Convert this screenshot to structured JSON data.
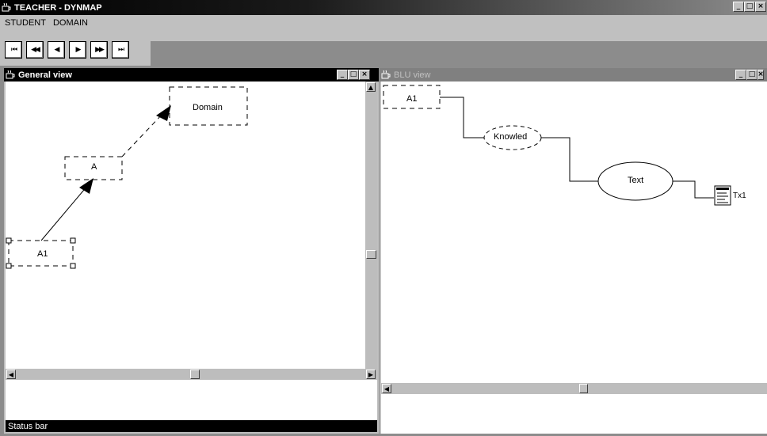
{
  "app": {
    "title": "TEACHER - DYNMAP"
  },
  "menu": {
    "items": [
      "STUDENT",
      "DOMAIN"
    ]
  },
  "toolbar": {
    "buttons": [
      {
        "name": "first",
        "glyph": "⏮"
      },
      {
        "name": "fast-back",
        "glyph": "◀◀"
      },
      {
        "name": "back",
        "glyph": "◀"
      },
      {
        "name": "play",
        "glyph": "▶"
      },
      {
        "name": "fast-forward",
        "glyph": "▶▶"
      },
      {
        "name": "last",
        "glyph": "⏭"
      }
    ]
  },
  "general_view": {
    "title": "General view",
    "nodes": {
      "domain": "Domain",
      "a": "A",
      "a1": "A1"
    },
    "status": "Status bar"
  },
  "blu_view": {
    "title": "BLU view",
    "nodes": {
      "a1": "A1",
      "knowledge": "Knowled",
      "text": "Text",
      "tx1": "Tx1"
    }
  },
  "window_controls": {
    "minimize": "_",
    "maximize": "□",
    "close": "×"
  }
}
